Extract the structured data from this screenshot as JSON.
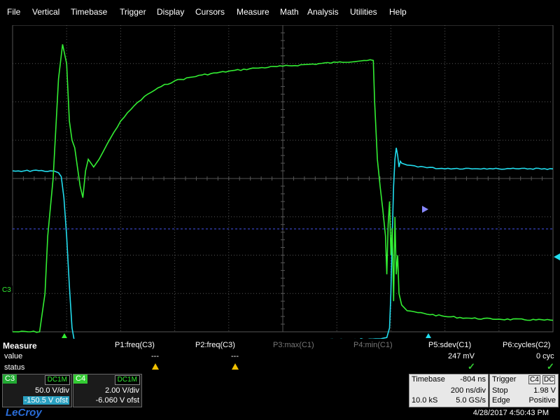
{
  "menu": [
    "File",
    "Vertical",
    "Timebase",
    "Trigger",
    "Display",
    "Cursors",
    "Measure",
    "Math",
    "Analysis",
    "Utilities",
    "Help"
  ],
  "scope": {
    "channel_marker": "C3",
    "colors": {
      "c3": "#33ee33",
      "c4": "#22ddee",
      "grid": "#555555",
      "bg": "#000000"
    }
  },
  "chart_data": {
    "type": "line",
    "x": {
      "unit": "ns",
      "per_div": 200,
      "divisions": 10,
      "delay": -804
    },
    "series": [
      {
        "channel": "C3",
        "volts_per_div": 50.0,
        "offset": -150.5,
        "color": "#33ee33",
        "points": [
          [
            -1000,
            -4
          ],
          [
            -900,
            -4
          ],
          [
            -880,
            -3
          ],
          [
            -870,
            -1.5
          ],
          [
            -850,
            0
          ],
          [
            -830,
            2.6
          ],
          [
            -815,
            3.5
          ],
          [
            -800,
            3.0
          ],
          [
            -790,
            1.5
          ],
          [
            -780,
            1.0
          ],
          [
            -770,
            0.8
          ],
          [
            -760,
            0.3
          ],
          [
            -750,
            -0.2
          ],
          [
            -740,
            -0.5
          ],
          [
            -730,
            0.2
          ],
          [
            -720,
            0.5
          ],
          [
            -700,
            0.3
          ],
          [
            -680,
            0.5
          ],
          [
            -650,
            0.9
          ],
          [
            -600,
            1.5
          ],
          [
            -550,
            1.9
          ],
          [
            -500,
            2.2
          ],
          [
            -450,
            2.4
          ],
          [
            -400,
            2.55
          ],
          [
            -300,
            2.7
          ],
          [
            -200,
            2.8
          ],
          [
            -100,
            2.88
          ],
          [
            0,
            2.93
          ],
          [
            100,
            2.98
          ],
          [
            200,
            3.03
          ],
          [
            300,
            3.08
          ],
          [
            335,
            3.08
          ],
          [
            340,
            2.0
          ],
          [
            350,
            0.5
          ],
          [
            360,
            -0.2
          ],
          [
            370,
            -0.8
          ],
          [
            380,
            -1.5
          ],
          [
            385,
            -2.5
          ],
          [
            390,
            -1.2
          ],
          [
            395,
            -0.6
          ],
          [
            400,
            -2.0
          ],
          [
            405,
            -1.3
          ],
          [
            410,
            -3.2
          ],
          [
            415,
            -1.0
          ],
          [
            420,
            -2.5
          ],
          [
            425,
            -2.0
          ],
          [
            430,
            -3.0
          ],
          [
            440,
            -3.3
          ],
          [
            460,
            -3.45
          ],
          [
            500,
            -3.5
          ],
          [
            600,
            -3.6
          ],
          [
            700,
            -3.65
          ],
          [
            800,
            -3.67
          ],
          [
            1000,
            -3.7
          ]
        ]
      },
      {
        "channel": "C4",
        "volts_per_div": 2.0,
        "offset": -6.06,
        "color": "#22ddee",
        "points": [
          [
            -1000,
            0.2
          ],
          [
            -860,
            0.2
          ],
          [
            -830,
            0.15
          ],
          [
            -820,
            0.05
          ],
          [
            -810,
            -0.5
          ],
          [
            -800,
            -1.5
          ],
          [
            -790,
            -2.8
          ],
          [
            -780,
            -3.9
          ],
          [
            -770,
            -4.3
          ],
          [
            -750,
            -4.3
          ],
          [
            -700,
            -4.3
          ],
          [
            -500,
            -4.3
          ],
          [
            -300,
            -4.27
          ],
          [
            -100,
            -4.25
          ],
          [
            100,
            -4.22
          ],
          [
            300,
            -4.2
          ],
          [
            385,
            -4.15
          ],
          [
            395,
            -3.9
          ],
          [
            400,
            -3.0
          ],
          [
            405,
            -1.5
          ],
          [
            410,
            -0.2
          ],
          [
            415,
            0.5
          ],
          [
            420,
            0.8
          ],
          [
            425,
            0.6
          ],
          [
            430,
            0.3
          ],
          [
            435,
            0.45
          ],
          [
            440,
            0.4
          ],
          [
            460,
            0.35
          ],
          [
            500,
            0.3
          ],
          [
            600,
            0.25
          ],
          [
            700,
            0.25
          ],
          [
            800,
            0.25
          ],
          [
            1000,
            0.25
          ]
        ]
      }
    ]
  },
  "measure": {
    "title": "Measure",
    "row_value": "value",
    "row_status": "status",
    "params": [
      {
        "label": "P1:freq(C3)",
        "value": "---",
        "status": "warn",
        "active": true
      },
      {
        "label": "P2:freq(C3)",
        "value": "---",
        "status": "warn",
        "active": true
      },
      {
        "label": "P3:max(C1)",
        "value": "",
        "status": "",
        "active": false
      },
      {
        "label": "P4:min(C1)",
        "value": "",
        "status": "",
        "active": false
      },
      {
        "label": "P5:sdev(C1)",
        "value": "247 mV",
        "status": "ok",
        "active": true
      },
      {
        "label": "P6:cycles(C2)",
        "value": "0 cyc",
        "status": "ok",
        "active": true
      }
    ]
  },
  "channels": {
    "c3": {
      "name": "C3",
      "coupling": "DC1M",
      "vdiv": "50.0 V/div",
      "offset": "-150.5 V ofst"
    },
    "c4": {
      "name": "C4",
      "coupling": "DC1M",
      "vdiv": "2.00 V/div",
      "offset": "-6.060 V ofst"
    }
  },
  "timebase": {
    "label": "Timebase",
    "delay": "-804 ns",
    "tdiv": "200 ns/div",
    "samples": "10.0 kS",
    "rate": "5.0 GS/s"
  },
  "trigger": {
    "label": "Trigger",
    "source": "C4",
    "coupling": "DC",
    "mode": "Stop",
    "level": "1.98 V",
    "type": "Edge",
    "slope": "Positive"
  },
  "footer": {
    "brand": "LeCroy",
    "datetime": "4/28/2017 4:50:43 PM"
  }
}
